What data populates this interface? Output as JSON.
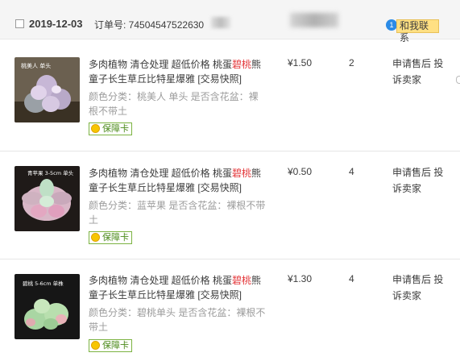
{
  "order": {
    "date": "2019-12-03",
    "order_label": "订单号: 74504547522630",
    "contact_label": "和我联系",
    "contact_icon": "chat-bubble-icon"
  },
  "items": [
    {
      "thumb_label": "桃美人 单头",
      "title_pre": "多肉植物 清仓处理 超低价格 桃蛋",
      "title_hl": "碧桃",
      "title_post": "熊童子长生草丘比特星爆雅 [交易快照]",
      "sku": "颜色分类：桃美人 单头  是否含花盆：裸根不带土",
      "badge": "保障卡",
      "price": "¥1.50",
      "qty": "2",
      "service": "申请售后 投诉卖家"
    },
    {
      "thumb_label": "青苹果 3-5cm 单头",
      "title_pre": "多肉植物 清仓处理 超低价格 桃蛋",
      "title_hl": "碧桃",
      "title_post": "熊童子长生草丘比特星爆雅 [交易快照]",
      "sku": "颜色分类：蓝苹果  是否含花盆：裸根不带土",
      "badge": "保障卡",
      "price": "¥0.50",
      "qty": "4",
      "service": "申请售后 投诉卖家"
    },
    {
      "thumb_label": "碧桃 5-6cm 单株",
      "title_pre": "多肉植物 清仓处理 超低价格 桃蛋",
      "title_hl": "碧桃",
      "title_post": "熊童子长生草丘比特星爆雅 [交易快照]",
      "sku": "颜色分类：碧桃单头  是否含花盆：裸根不带土",
      "badge": "保障卡",
      "price": "¥1.30",
      "qty": "4",
      "service": "申请售后 投诉卖家"
    }
  ],
  "colors": {
    "highlight": "#e4393c",
    "badge_border": "#7cb342",
    "header_bg": "#f5f5f5"
  }
}
